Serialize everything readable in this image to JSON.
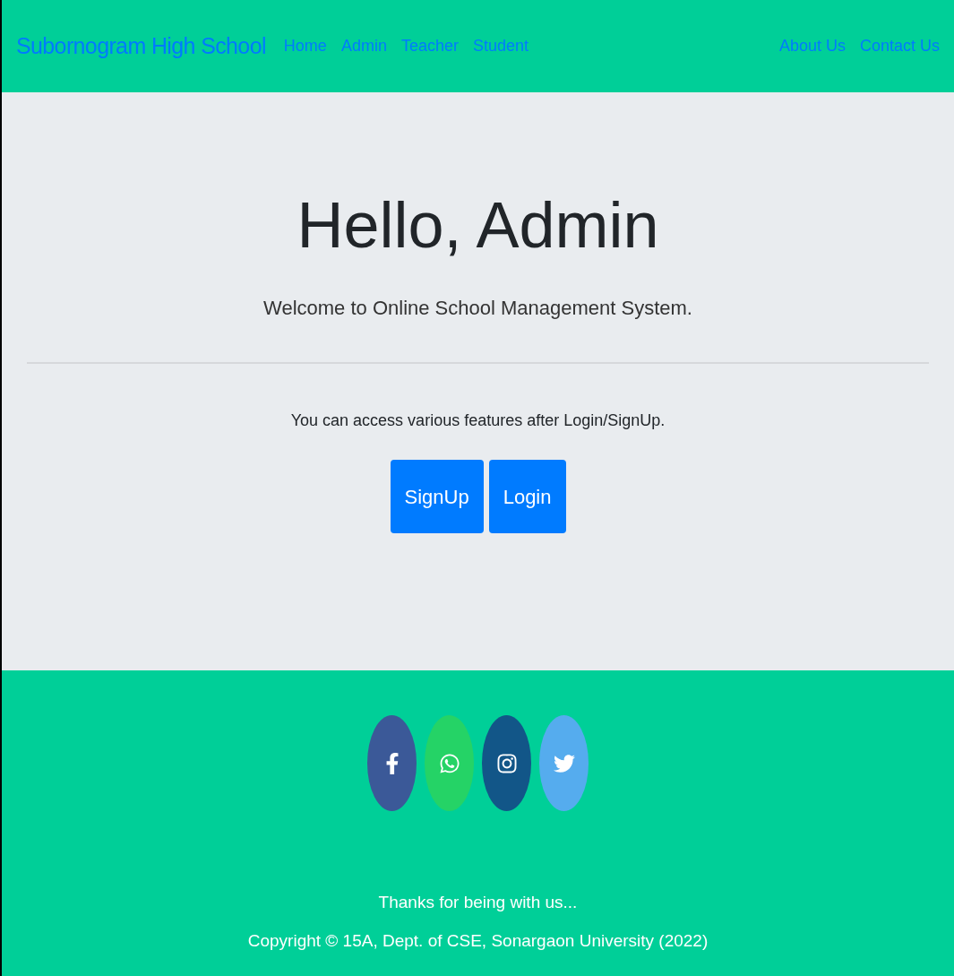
{
  "navbar": {
    "brand": "Subornogram High School",
    "links": [
      "Home",
      "Admin",
      "Teacher",
      "Student"
    ],
    "right_links": [
      "About Us",
      "Contact Us"
    ]
  },
  "hero": {
    "title": "Hello, Admin",
    "subtitle": "Welcome to Online School Management System.",
    "note": "You can access various features after Login/SignUp.",
    "buttons": [
      "SignUp",
      "Login"
    ]
  },
  "footer": {
    "social": [
      {
        "kind": "facebook",
        "color": "#3b5998"
      },
      {
        "kind": "whatsapp",
        "color": "#25d366"
      },
      {
        "kind": "instagram",
        "color": "#125688"
      },
      {
        "kind": "twitter",
        "color": "#55acee"
      }
    ],
    "thanks": "Thanks for being with us...",
    "copyright": "Copyright © 15A, Dept. of CSE, Sonargaon University (2022)"
  }
}
